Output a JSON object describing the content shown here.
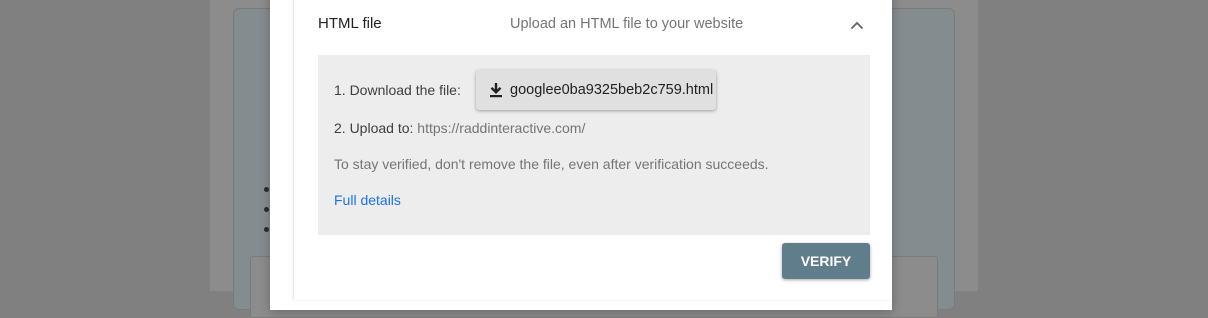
{
  "verification_method": {
    "title": "HTML file",
    "description": "Upload an HTML file to your website",
    "collapse_icon": "chevron-up-icon"
  },
  "steps": {
    "download_label": "1. Download the file:",
    "download_file": "googlee0ba9325beb2c759.html",
    "download_icon": "download-icon",
    "upload_label": "2. Upload to:",
    "upload_url": "https://raddinteractive.com/"
  },
  "note": "To stay verified, don't remove the file, even after verification succeeds.",
  "details_link": "Full details",
  "verify_label": "VERIFY",
  "colors": {
    "accent": "#607d8b",
    "link": "#1a73e8",
    "panel": "#ededed",
    "overlay": "#808080"
  }
}
